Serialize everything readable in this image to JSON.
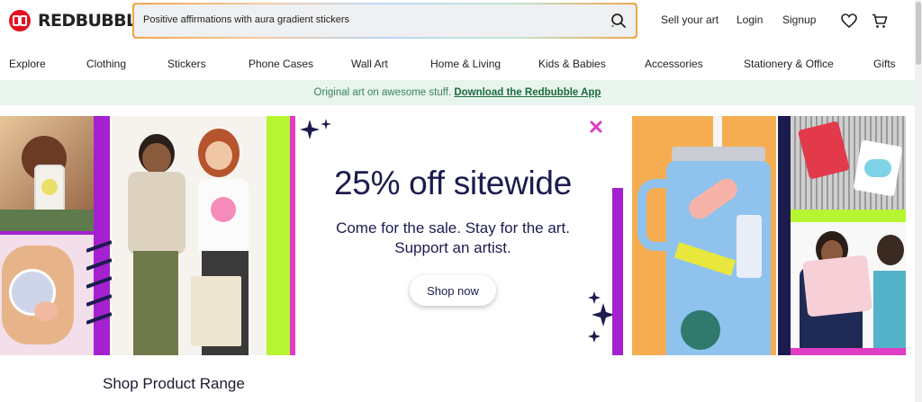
{
  "brand": {
    "name": "REDBUBBLE",
    "accent": "#e41321"
  },
  "search": {
    "value": "Positive affirmations with aura gradient stickers",
    "icon": "search-icon"
  },
  "header": {
    "sell": "Sell your art",
    "login": "Login",
    "signup": "Signup"
  },
  "categories": [
    "Explore",
    "Clothing",
    "Stickers",
    "Phone Cases",
    "Wall Art",
    "Home & Living",
    "Kids & Babies",
    "Accessories",
    "Stationery & Office",
    "Gifts"
  ],
  "promo": {
    "text": "Original art on awesome stuff.",
    "link": "Download the Redbubble App"
  },
  "hero": {
    "title": "25% off sitewide",
    "line1": "Come for the sale. Stay for the art.",
    "line2": "Support an artist.",
    "cta": "Shop now"
  },
  "section": {
    "title": "Shop Product Range"
  },
  "colors": {
    "navy": "#1c1b4e",
    "magenta": "#c02ad6",
    "lime": "#b6f532",
    "promo_bg": "#e7f5ec"
  }
}
